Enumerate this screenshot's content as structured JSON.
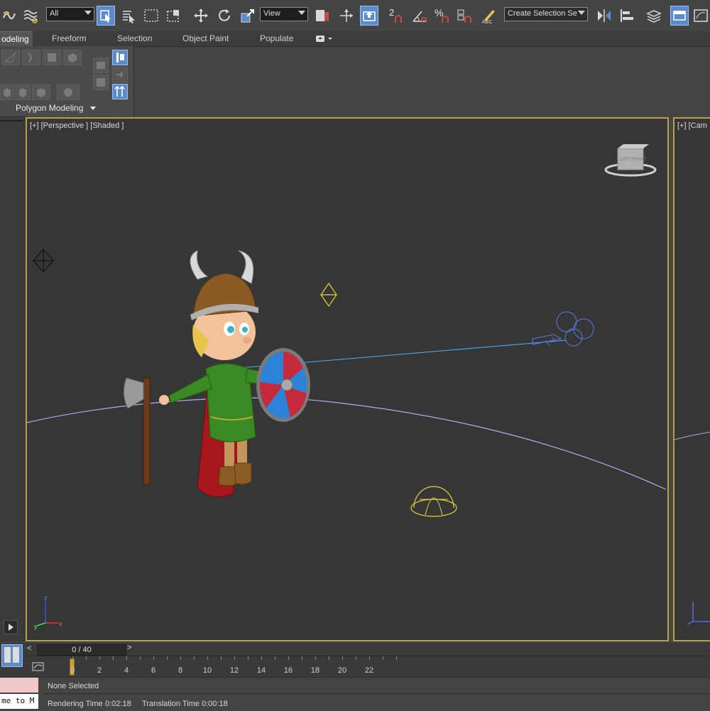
{
  "toolbar": {
    "selection_filter": "All",
    "reference_coord": "View",
    "named_selection_placeholder": "Create Selection Se",
    "snap_toggle_label": "2",
    "percent_snap_label": "%"
  },
  "ribbon": {
    "tabs": [
      {
        "label": "odeling",
        "active": true
      },
      {
        "label": "Freeform",
        "active": false
      },
      {
        "label": "Selection",
        "active": false
      },
      {
        "label": "Object Paint",
        "active": false
      },
      {
        "label": "Populate",
        "active": false
      }
    ],
    "panel_title": "Polygon Modeling"
  },
  "viewport": {
    "label": "[+] [Perspective ] [Shaded ]",
    "second_label": "[+] [Cam",
    "viewcube_left": "LEFT",
    "viewcube_front": "FRONT",
    "axis_labels": {
      "x": "x",
      "y": "y",
      "z": "z"
    }
  },
  "time_slider": {
    "frame_display": "0 / 40",
    "prev_label": "<",
    "next_label": ">"
  },
  "trackbar": {
    "ticks": [
      "0",
      "2",
      "4",
      "6",
      "8",
      "10",
      "12",
      "14",
      "16",
      "18",
      "20",
      "22"
    ]
  },
  "status": {
    "maxscript_line1": "",
    "maxscript_line2": "me to M",
    "selection": "None Selected",
    "rendering_time_label": "Rendering Time",
    "rendering_time": "0:02:18",
    "translation_time_label": "Translation Time",
    "translation_time": "0:00:18"
  },
  "colors": {
    "viewport_border": "#b9a04a",
    "active_button": "#5b8bc9",
    "spline": "#b4a8f0",
    "gizmo_yellow": "#e6d23a",
    "rig_blue": "#5a78e8"
  }
}
